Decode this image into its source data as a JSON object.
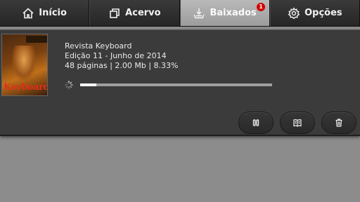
{
  "tabs": [
    {
      "label": "Início",
      "icon": "home-icon",
      "active": false
    },
    {
      "label": "Acervo",
      "icon": "collection-icon",
      "active": false
    },
    {
      "label": "Baixados",
      "icon": "download-icon",
      "active": true,
      "badge": "1"
    },
    {
      "label": "Opções",
      "icon": "gear-icon",
      "active": false
    }
  ],
  "download": {
    "cover_logo": "Keyboard",
    "title": "Revista Keyboard",
    "edition": "Edição 11 - Junho de 2014",
    "details": "48 páginas | 2.00 Mb | 8.33%",
    "progress_percent": 8.33
  },
  "actions": {
    "pause_icon": "pause-icon",
    "read_icon": "open-book-icon",
    "delete_icon": "trash-icon"
  },
  "colors": {
    "tabbar": "#2f2f2f",
    "active_tab": "#aaaaaa",
    "badge": "#d40000",
    "card": "#3b3b3b",
    "background": "#8c8c8c"
  }
}
